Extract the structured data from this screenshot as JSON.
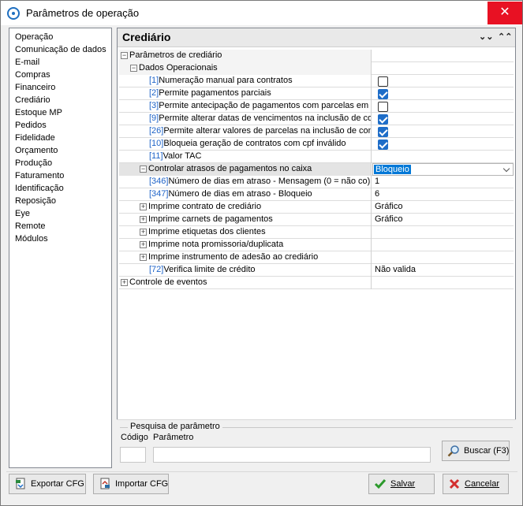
{
  "window": {
    "title": "Parâmetros de operação",
    "close_icon": "✕"
  },
  "sidebar": {
    "items": [
      "Operação",
      "Comunicação de dados",
      "E-mail",
      "Compras",
      "Financeiro",
      "Crediário",
      "Estoque MP",
      "Pedidos",
      "Fidelidade",
      "Orçamento",
      "Produção",
      "Faturamento",
      "Identificação",
      "Reposição",
      "Eye",
      "Remote",
      "Módulos"
    ]
  },
  "panel": {
    "title": "Crediário",
    "collapse_icon": "⌄⌄",
    "expand_icon": "⌃⌃"
  },
  "grid": {
    "rows": [
      {
        "label": "Parâmetros de crediário",
        "type": "group",
        "toggle": "−"
      },
      {
        "label": "Dados Operacionais",
        "type": "group",
        "toggle": "−"
      },
      {
        "code": "[1]",
        "label": "Numeração manual para contratos",
        "type": "checkbox",
        "checked": false
      },
      {
        "code": "[2]",
        "label": "Permite pagamentos parciais",
        "type": "checkbox",
        "checked": true
      },
      {
        "code": "[3]",
        "label": "Permite antecipação de pagamentos com parcelas em o",
        "type": "checkbox",
        "checked": false
      },
      {
        "code": "[9]",
        "label": "Permite alterar datas de vencimentos na inclusão de coo",
        "type": "checkbox",
        "checked": true
      },
      {
        "code": "[26]",
        "label": "Permite alterar valores de parcelas na inclusão de cono",
        "type": "checkbox",
        "checked": true
      },
      {
        "code": "[10]",
        "label": "Bloqueia geração de contratos com cpf inválido",
        "type": "checkbox",
        "checked": true
      },
      {
        "code": "[11]",
        "label": "Valor TAC",
        "type": "text",
        "value": ""
      },
      {
        "label": "Controlar atrasos de pagamentos no caixa",
        "type": "dropdown",
        "toggle": "−",
        "value": "Bloqueio"
      },
      {
        "code": "[346]",
        "label": "Número de dias em atraso - Mensagem (0 = não co)",
        "type": "text",
        "value": "1"
      },
      {
        "code": "[347]",
        "label": "Número de dias em atraso - Bloqueio",
        "type": "text",
        "value": "6"
      },
      {
        "label": "Imprime contrato de crediário",
        "type": "text",
        "toggle": "+",
        "value": "Gráfico"
      },
      {
        "label": "Imprime carnets de pagamentos",
        "type": "text",
        "toggle": "+",
        "value": "Gráfico"
      },
      {
        "label": "Imprime etiquetas dos clientes",
        "type": "text",
        "toggle": "+",
        "value": ""
      },
      {
        "label": "Imprime nota promissoria/duplicata",
        "type": "text",
        "toggle": "+",
        "value": ""
      },
      {
        "label": "Imprime instrumento de adesão ao crediário",
        "type": "text",
        "toggle": "+",
        "value": ""
      },
      {
        "code": "[72]",
        "label": "Verifica limite de crédito",
        "type": "text",
        "value": "Não valida"
      },
      {
        "label": "Controle de eventos",
        "type": "text",
        "toggle": "+",
        "value": ""
      }
    ]
  },
  "search": {
    "legend": "Pesquisa de parâmetro",
    "code_label": "Código",
    "param_label": "Parâmetro",
    "code_value": "",
    "param_value": "",
    "button_label": "Buscar (F3)"
  },
  "footer": {
    "export_label": "Exportar CFG",
    "import_label": "Importar CFG",
    "save_label": "Salvar",
    "cancel_label": "Cancelar"
  },
  "colors": {
    "close": "#e81123",
    "accent": "#1e6dc8",
    "code_text": "#1e63c8",
    "selection": "#0078d7"
  }
}
